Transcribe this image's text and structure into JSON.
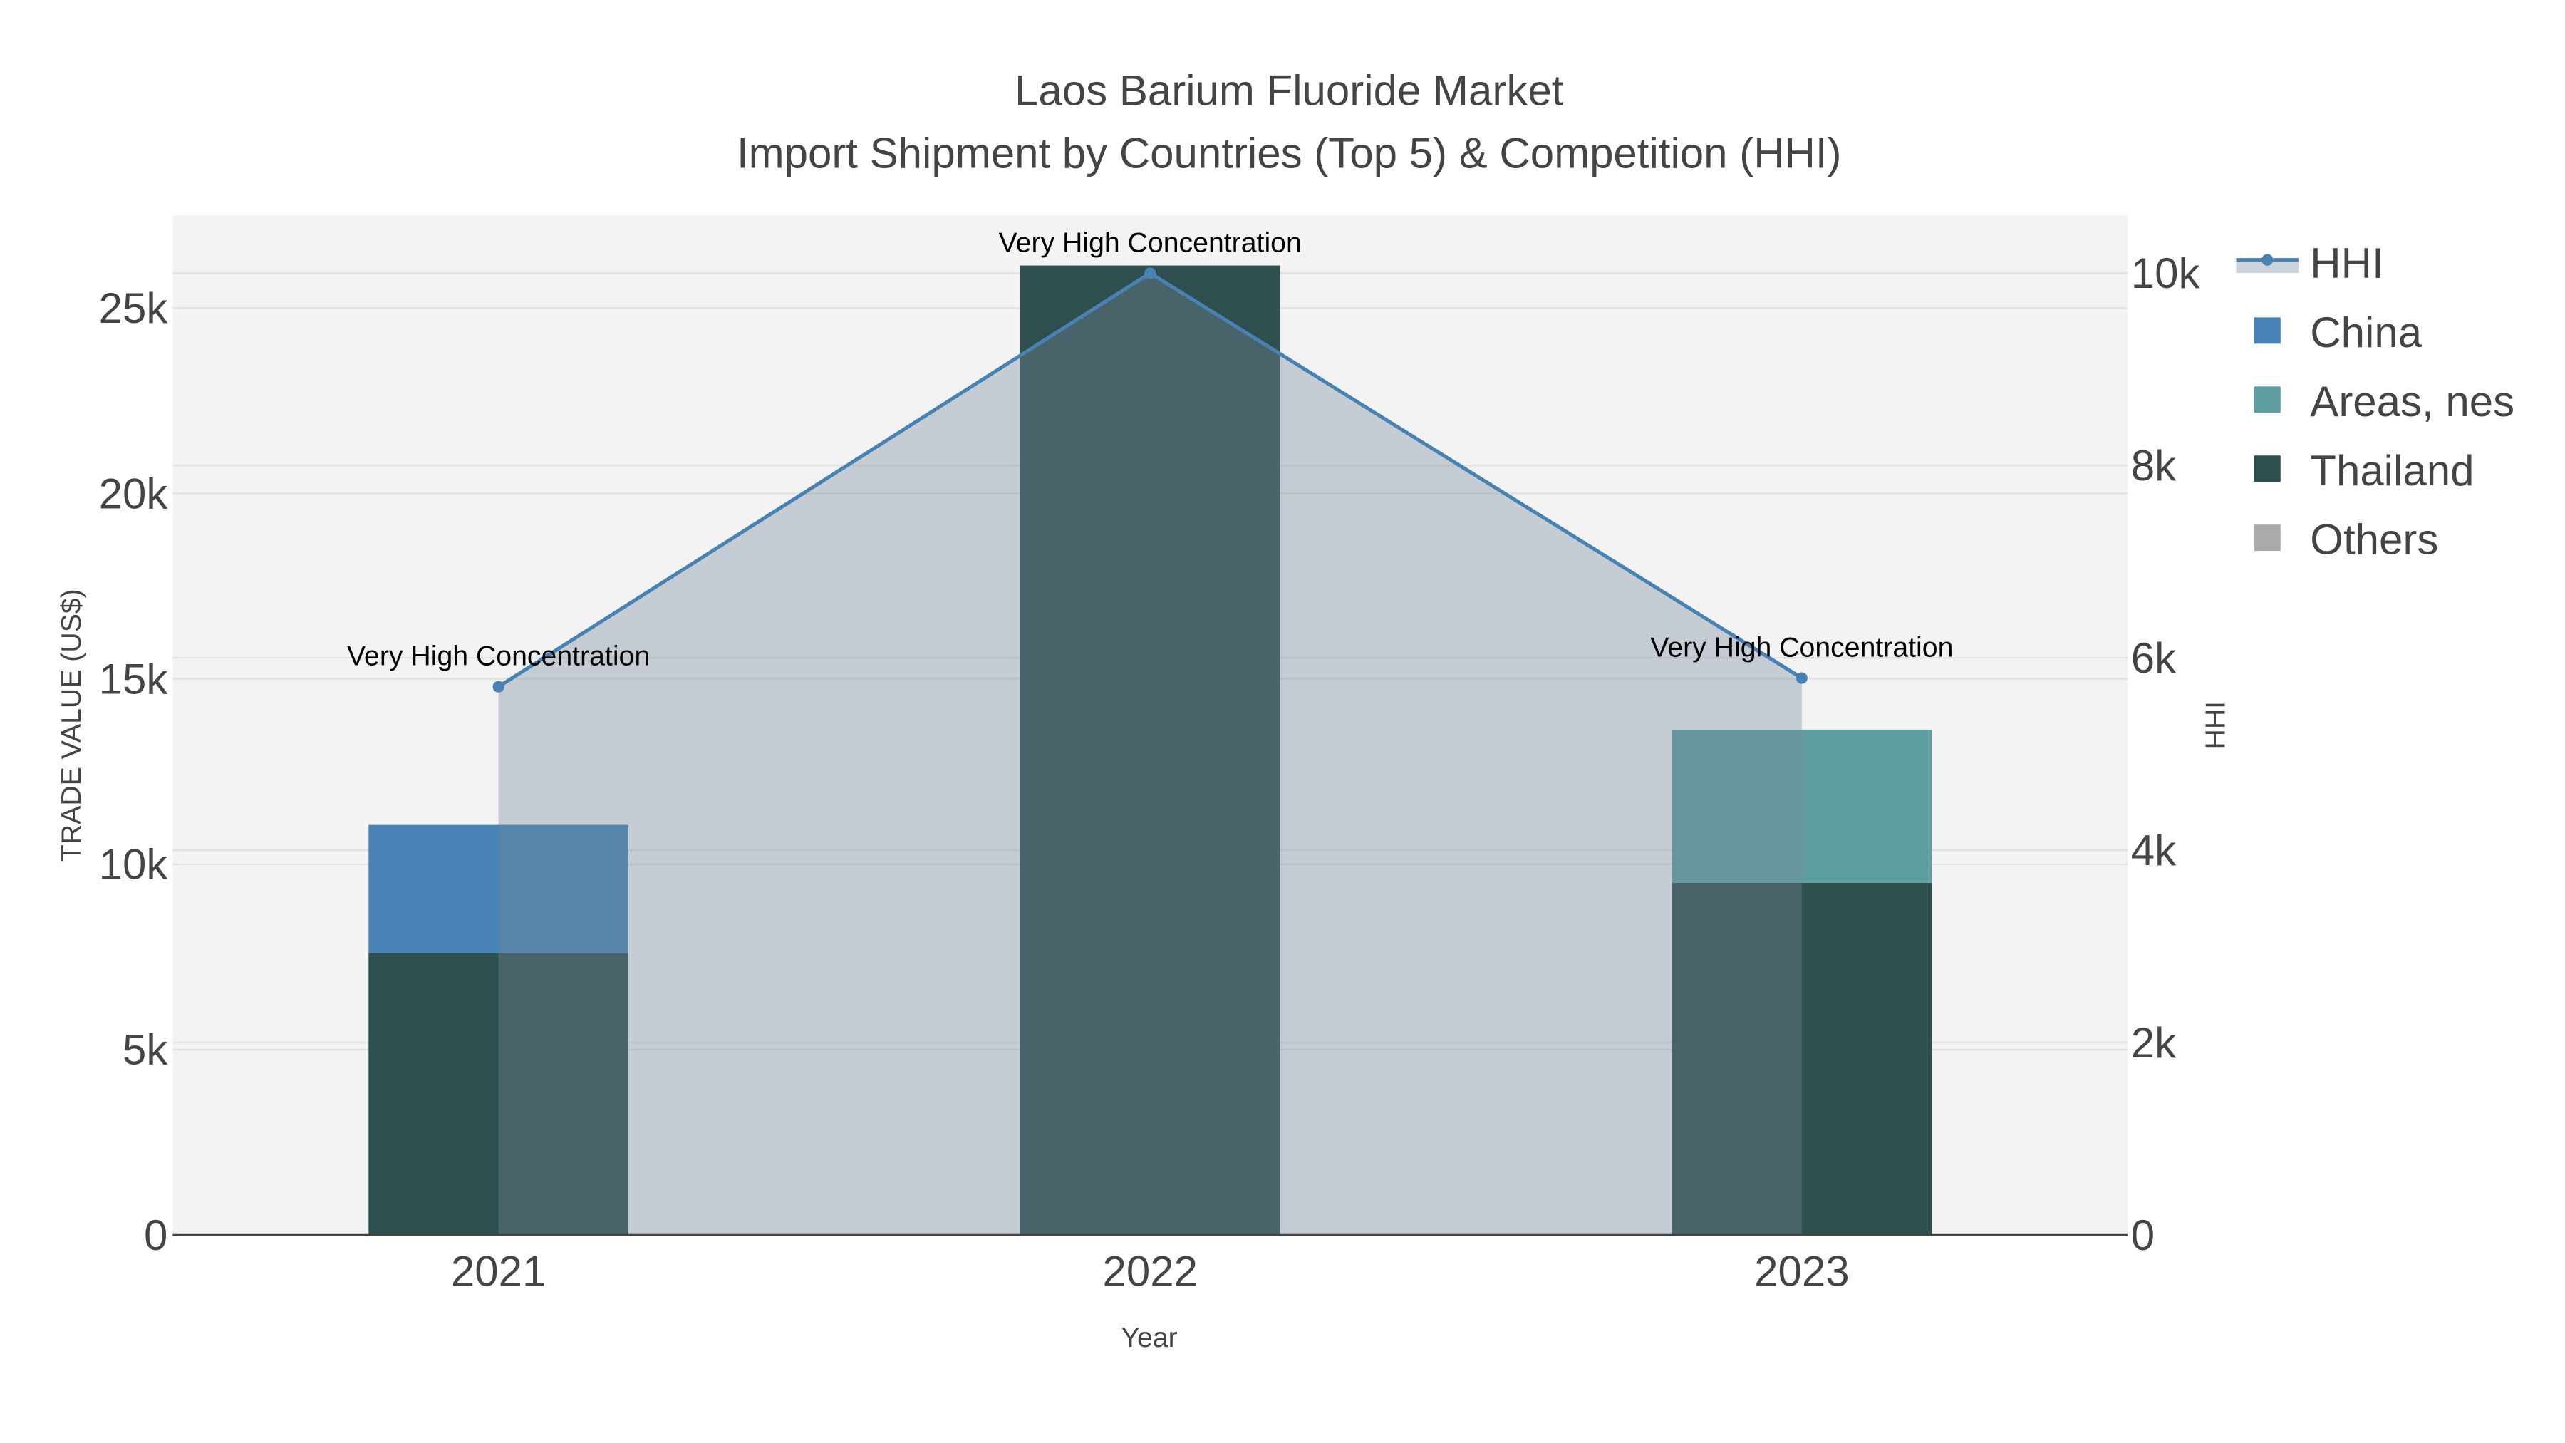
{
  "chart_data": {
    "type": "bar",
    "title": "Laos Barium Fluoride Market",
    "subtitle": "Import Shipment by Countries (Top 5) & Competition (HHI)",
    "xlabel": "Year",
    "ylabel": "TRADE VALUE (US$)",
    "y2label": "HHI",
    "categories": [
      "2021",
      "2022",
      "2023"
    ],
    "ylim": [
      0,
      27500
    ],
    "y2lim": [
      0,
      10600
    ],
    "yticks": [
      {
        "v": 0,
        "label": "0"
      },
      {
        "v": 5000,
        "label": "5k"
      },
      {
        "v": 10000,
        "label": "10k"
      },
      {
        "v": 15000,
        "label": "15k"
      },
      {
        "v": 20000,
        "label": "20k"
      },
      {
        "v": 25000,
        "label": "25k"
      }
    ],
    "y2ticks": [
      {
        "v": 0,
        "label": "0"
      },
      {
        "v": 2000,
        "label": "2k"
      },
      {
        "v": 4000,
        "label": "4k"
      },
      {
        "v": 6000,
        "label": "6k"
      },
      {
        "v": 8000,
        "label": "8k"
      },
      {
        "v": 10000,
        "label": "10k"
      }
    ],
    "barmode": "stack",
    "grid": true,
    "legend_placement": "top-right",
    "series": [
      {
        "name": "Thailand",
        "color": "#2f4f4f",
        "values": [
          7600,
          26150,
          9500
        ]
      },
      {
        "name": "China",
        "color": "#4682b4",
        "values": [
          3460,
          0,
          0
        ]
      },
      {
        "name": "Areas, nes",
        "color": "#5f9ea0",
        "values": [
          0,
          0,
          4130
        ]
      },
      {
        "name": "Others",
        "color": "#aaaaaa",
        "values": [
          0,
          0,
          0
        ]
      }
    ],
    "hhi": {
      "name": "HHI",
      "color": "#4682b4",
      "values": [
        5700,
        10000,
        5790
      ]
    },
    "annotations": [
      "Very High Concentration",
      "Very High Concentration",
      "Very High Concentration"
    ],
    "legend": [
      "HHI",
      "China",
      "Areas, nes",
      "Thailand",
      "Others"
    ]
  }
}
